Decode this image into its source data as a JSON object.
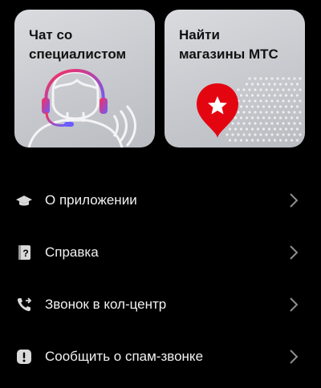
{
  "cards": [
    {
      "title": "Чат со\nспециалистом",
      "icon": "support-agent-icon"
    },
    {
      "title": "Найти\nмагазины МТС",
      "icon": "map-star-pin-icon"
    }
  ],
  "menu": {
    "items": [
      {
        "label": "О приложении",
        "icon": "graduation-cap-icon"
      },
      {
        "label": "Справка",
        "icon": "help-book-icon"
      },
      {
        "label": "Звонок в кол-центр",
        "icon": "phone-call-icon"
      },
      {
        "label": "Сообщить о спам-звонке",
        "icon": "exclamation-badge-icon"
      }
    ]
  },
  "colors": {
    "background": "#000000",
    "card_background": "#cfd1d5",
    "accent_red": "#e30611",
    "headset_gradient_start": "#ff2d55",
    "headset_gradient_end": "#6a5cff"
  }
}
